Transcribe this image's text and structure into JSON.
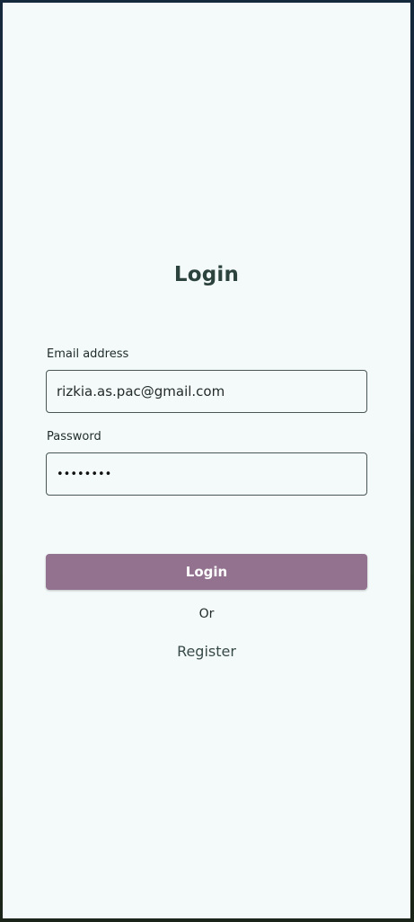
{
  "login": {
    "title": "Login",
    "email": {
      "label": "Email address",
      "value": "rizkia.as.pac@gmail.com"
    },
    "password": {
      "label": "Password",
      "value": "••••••••"
    },
    "submit_label": "Login",
    "separator": "Or",
    "register_label": "Register"
  },
  "colors": {
    "background": "#f4fafa",
    "title": "#2b423d",
    "button": "#937290",
    "button_text": "#ffffff"
  }
}
